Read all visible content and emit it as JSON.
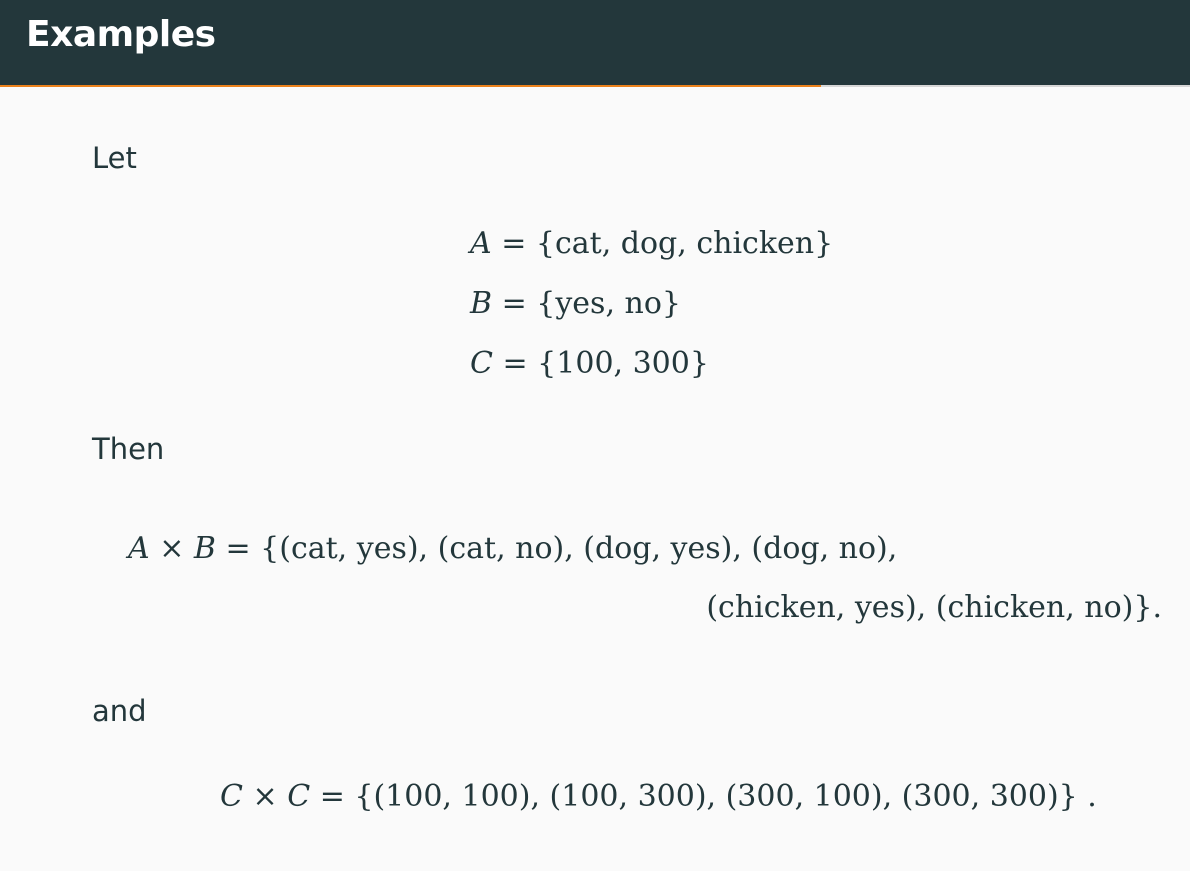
{
  "slide": {
    "title": "Examples",
    "progress_fraction": 0.69
  },
  "body": {
    "let_text": "Let",
    "sets": [
      {
        "var": "A",
        "rhs": " = {cat, dog, chicken}"
      },
      {
        "var": "B",
        "rhs": " = {yes, no}"
      },
      {
        "var": "C",
        "rhs": " = {100, 300}"
      }
    ],
    "then_text": "Then",
    "axb": {
      "lhs_a": "A",
      "times": " × ",
      "lhs_b": "B",
      "line1": " = {(cat, yes), (cat, no), (dog, yes), (dog, no),",
      "line2": "(chicken, yes), (chicken, no)}."
    },
    "and_text": "and",
    "cxc": {
      "lhs_a": "C",
      "times": " × ",
      "lhs_b": "C",
      "rhs": " = {(100, 100), (100, 300), (300, 100), (300, 300)} ."
    }
  }
}
